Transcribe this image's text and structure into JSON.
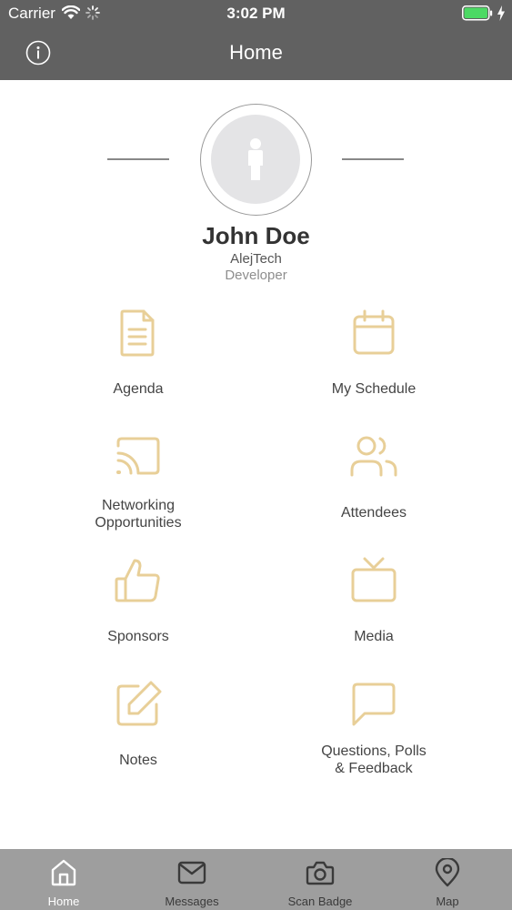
{
  "status_bar": {
    "carrier": "Carrier",
    "time": "3:02 PM",
    "battery_color": "#4cd964"
  },
  "nav": {
    "title": "Home",
    "info_icon": "info-circle-icon"
  },
  "profile": {
    "name": "John Doe",
    "company": "AlejTech",
    "role": "Developer",
    "avatar_icon": "person-silhouette-icon"
  },
  "colors": {
    "header_bg": "#616161",
    "icon_accent": "#e8cf98",
    "tab_bar_bg": "#9e9e9e"
  },
  "menu": [
    {
      "id": "agenda",
      "label": "Agenda",
      "icon": "document-icon"
    },
    {
      "id": "my-schedule",
      "label": "My Schedule",
      "icon": "calendar-icon"
    },
    {
      "id": "networking",
      "label": "Networking\nOpportunities",
      "icon": "cast-icon"
    },
    {
      "id": "attendees",
      "label": "Attendees",
      "icon": "users-icon"
    },
    {
      "id": "sponsors",
      "label": "Sponsors",
      "icon": "thumbs-up-icon"
    },
    {
      "id": "media",
      "label": "Media",
      "icon": "tv-icon"
    },
    {
      "id": "notes",
      "label": "Notes",
      "icon": "edit-icon"
    },
    {
      "id": "questions",
      "label": "Questions, Polls\n& Feedback",
      "icon": "chat-bubble-icon"
    }
  ],
  "tabs": [
    {
      "label": "Home",
      "icon": "home-icon",
      "active": true
    },
    {
      "label": "Messages",
      "icon": "mail-icon",
      "active": false
    },
    {
      "label": "Scan Badge",
      "icon": "camera-icon",
      "active": false
    },
    {
      "label": "Map",
      "icon": "map-pin-icon",
      "active": false
    }
  ]
}
